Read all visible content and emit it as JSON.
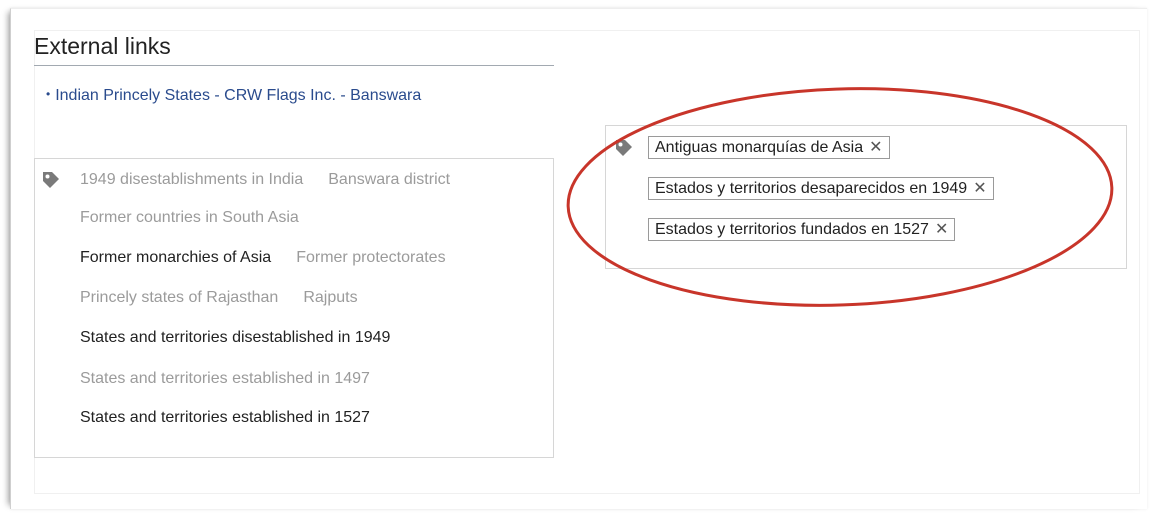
{
  "section": {
    "heading": "External links"
  },
  "external_links": [
    {
      "bullet": "•",
      "text": "Indian Princely States - CRW Flags Inc. - Banswara"
    }
  ],
  "categories_en": {
    "icon": "tag-icon",
    "lines": [
      [
        {
          "text": "1949 disestablishments in India",
          "style": "dim"
        },
        {
          "text": "Banswara district",
          "style": "dim"
        }
      ],
      [
        {
          "text": "Former countries in South Asia",
          "style": "dim"
        }
      ],
      [
        {
          "text": "Former monarchies of Asia",
          "style": "dark"
        },
        {
          "text": "Former protectorates",
          "style": "dim"
        }
      ],
      [
        {
          "text": "Princely states of Rajasthan",
          "style": "dim"
        },
        {
          "text": "Rajputs",
          "style": "dim"
        }
      ],
      [
        {
          "text": "States and territories disestablished in 1949",
          "style": "dark"
        }
      ],
      [
        {
          "text": "States and territories established in 1497",
          "style": "dim"
        }
      ],
      [
        {
          "text": "States and territories established in 1527",
          "style": "dark"
        }
      ]
    ]
  },
  "categories_es": {
    "icon": "tag-icon",
    "chips": [
      {
        "label": "Antiguas monarquías de Asia",
        "remove": "✕"
      },
      {
        "label": "Estados y territorios desaparecidos en 1949",
        "remove": "✕"
      },
      {
        "label": "Estados y territorios fundados en 1527",
        "remove": "✕"
      }
    ]
  },
  "colors": {
    "link": "#2a4b8d",
    "dim_text": "#9b9b9b",
    "dark_text": "#222222",
    "annotation": "#c8352a",
    "tag_icon": "#7a7a7a"
  }
}
